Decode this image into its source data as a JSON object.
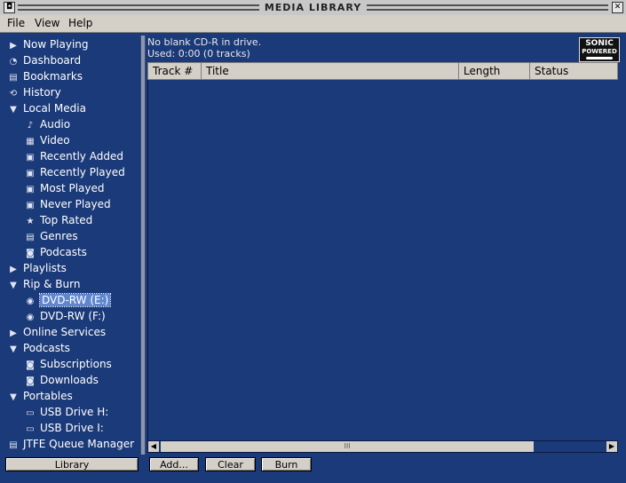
{
  "window": {
    "title": "MEDIA LIBRARY",
    "menu": [
      {
        "name": "menu-file",
        "label": "File"
      },
      {
        "name": "menu-view",
        "label": "View"
      },
      {
        "name": "menu-help",
        "label": "Help"
      }
    ]
  },
  "sidebar": {
    "items": [
      {
        "name": "nav-now-playing",
        "label": "Now Playing",
        "icon": "play-icon",
        "glyph": "▶",
        "level": 0,
        "selected": false
      },
      {
        "name": "nav-dashboard",
        "label": "Dashboard",
        "icon": "dashboard-icon",
        "glyph": "◔",
        "level": 0,
        "selected": false
      },
      {
        "name": "nav-bookmarks",
        "label": "Bookmarks",
        "icon": "bookmark-icon",
        "glyph": "▤",
        "level": 0,
        "selected": false
      },
      {
        "name": "nav-history",
        "label": "History",
        "icon": "history-icon",
        "glyph": "⟲",
        "level": 0,
        "selected": false
      },
      {
        "name": "nav-local-media",
        "label": "Local Media",
        "icon": "expanded-arrow-icon",
        "glyph": "▼",
        "level": 0,
        "selected": false
      },
      {
        "name": "nav-audio",
        "label": "Audio",
        "icon": "speaker-icon",
        "glyph": "♪",
        "level": 1,
        "selected": false
      },
      {
        "name": "nav-video",
        "label": "Video",
        "icon": "film-icon",
        "glyph": "▦",
        "level": 1,
        "selected": false
      },
      {
        "name": "nav-recently-added",
        "label": "Recently Added",
        "icon": "smart-view-icon",
        "glyph": "▣",
        "level": 1,
        "selected": false
      },
      {
        "name": "nav-recently-played",
        "label": "Recently Played",
        "icon": "smart-view-icon",
        "glyph": "▣",
        "level": 1,
        "selected": false
      },
      {
        "name": "nav-most-played",
        "label": "Most Played",
        "icon": "smart-view-icon",
        "glyph": "▣",
        "level": 1,
        "selected": false
      },
      {
        "name": "nav-never-played",
        "label": "Never Played",
        "icon": "smart-view-icon",
        "glyph": "▣",
        "level": 1,
        "selected": false
      },
      {
        "name": "nav-top-rated",
        "label": "Top Rated",
        "icon": "star-icon",
        "glyph": "★",
        "level": 1,
        "selected": false
      },
      {
        "name": "nav-genres",
        "label": "Genres",
        "icon": "document-icon",
        "glyph": "▤",
        "level": 1,
        "selected": false
      },
      {
        "name": "nav-podcasts-local",
        "label": "Podcasts",
        "icon": "podcast-icon",
        "glyph": "◙",
        "level": 1,
        "selected": false
      },
      {
        "name": "nav-playlists",
        "label": "Playlists",
        "icon": "collapsed-arrow-icon",
        "glyph": "▶",
        "level": 0,
        "selected": false
      },
      {
        "name": "nav-rip-burn",
        "label": "Rip & Burn",
        "icon": "expanded-arrow-icon",
        "glyph": "▼",
        "level": 0,
        "selected": false
      },
      {
        "name": "nav-dvd-e",
        "label": "DVD-RW (E:)",
        "icon": "disc-icon",
        "glyph": "◉",
        "level": 1,
        "selected": true
      },
      {
        "name": "nav-dvd-f",
        "label": "DVD-RW (F:)",
        "icon": "disc-icon",
        "glyph": "◉",
        "level": 1,
        "selected": false
      },
      {
        "name": "nav-online-services",
        "label": "Online Services",
        "icon": "collapsed-arrow-icon",
        "glyph": "▶",
        "level": 0,
        "selected": false
      },
      {
        "name": "nav-podcasts",
        "label": "Podcasts",
        "icon": "expanded-arrow-icon",
        "glyph": "▼",
        "level": 0,
        "selected": false
      },
      {
        "name": "nav-subscriptions",
        "label": "Subscriptions",
        "icon": "podcast-icon",
        "glyph": "◙",
        "level": 1,
        "selected": false
      },
      {
        "name": "nav-downloads",
        "label": "Downloads",
        "icon": "download-icon",
        "glyph": "◙",
        "level": 1,
        "selected": false
      },
      {
        "name": "nav-portables",
        "label": "Portables",
        "icon": "expanded-arrow-icon",
        "glyph": "▼",
        "level": 0,
        "selected": false
      },
      {
        "name": "nav-usb-h",
        "label": "USB Drive H:",
        "icon": "usb-drive-icon",
        "glyph": "▭",
        "level": 1,
        "selected": false
      },
      {
        "name": "nav-usb-i",
        "label": "USB Drive I:",
        "icon": "usb-drive-icon",
        "glyph": "▭",
        "level": 1,
        "selected": false
      },
      {
        "name": "nav-jtfe",
        "label": "JTFE Queue Manager",
        "icon": "document-icon",
        "glyph": "▤",
        "level": 0,
        "selected": false
      }
    ],
    "library_button": "Library"
  },
  "main": {
    "status_line1": "No blank CD-R in drive.",
    "status_line2": "Used: 0:00 (0 tracks)",
    "logo_line1": "SONIC",
    "logo_line2": "POWERED",
    "columns": [
      "Track #",
      "Title",
      "Length",
      "Status"
    ],
    "rows": [],
    "scroll_grip": "III"
  },
  "buttons": {
    "add": "Add...",
    "clear": "Clear",
    "burn": "Burn"
  }
}
